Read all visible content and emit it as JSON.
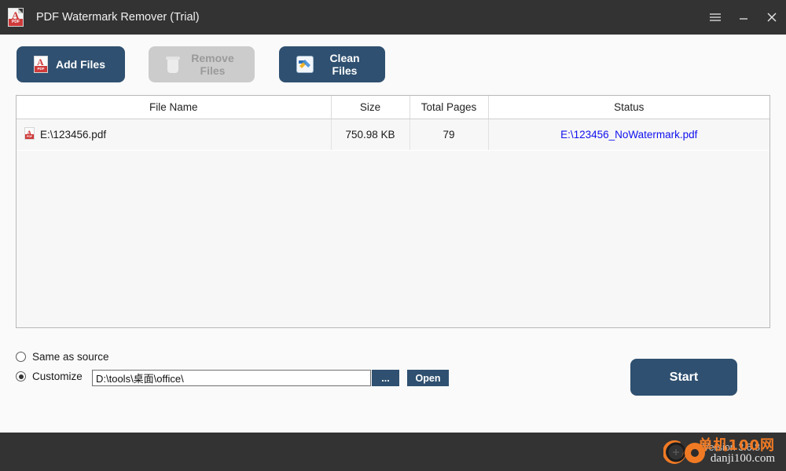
{
  "window": {
    "title": "PDF Watermark Remover (Trial)",
    "app_icon": "pdf-file-icon",
    "controls": [
      {
        "name": "menu",
        "icon": "hamburger-menu-icon"
      },
      {
        "name": "minimize",
        "icon": "minimize-icon"
      },
      {
        "name": "close",
        "icon": "close-icon"
      }
    ]
  },
  "toolbar": {
    "add_files": {
      "label": "Add Files",
      "icon": "pdf-file-icon",
      "enabled": true
    },
    "remove_files": {
      "label": "Remove Files",
      "icon": "trash-can-icon",
      "enabled": false
    },
    "clean_files": {
      "label": "Clean Files",
      "icon": "clean-brush-icon",
      "enabled": true
    }
  },
  "file_list": {
    "columns": [
      "File Name",
      "Size",
      "Total Pages",
      "Status"
    ],
    "rows": [
      {
        "icon": "pdf-file-icon",
        "file_name": "E:\\123456.pdf",
        "size": "750.98 KB",
        "total_pages": "79",
        "status": "E:\\123456_NoWatermark.pdf"
      }
    ]
  },
  "output": {
    "same_as_source": {
      "label": "Same as source",
      "selected": false
    },
    "customize": {
      "label": "Customize",
      "selected": true
    },
    "path_value": "D:\\tools\\桌面\\office\\",
    "browse_label": "...",
    "open_label": "Open",
    "start_label": "Start"
  },
  "footer": {
    "version": "Version 3.6.8",
    "watermark_text": "单机100网",
    "watermark_site": "danji100.com"
  },
  "colors": {
    "titlebar": "#333333",
    "accent": "#2f5070",
    "body": "#fafafa",
    "link": "#1010ee",
    "watermark_orange": "#f07a24"
  }
}
